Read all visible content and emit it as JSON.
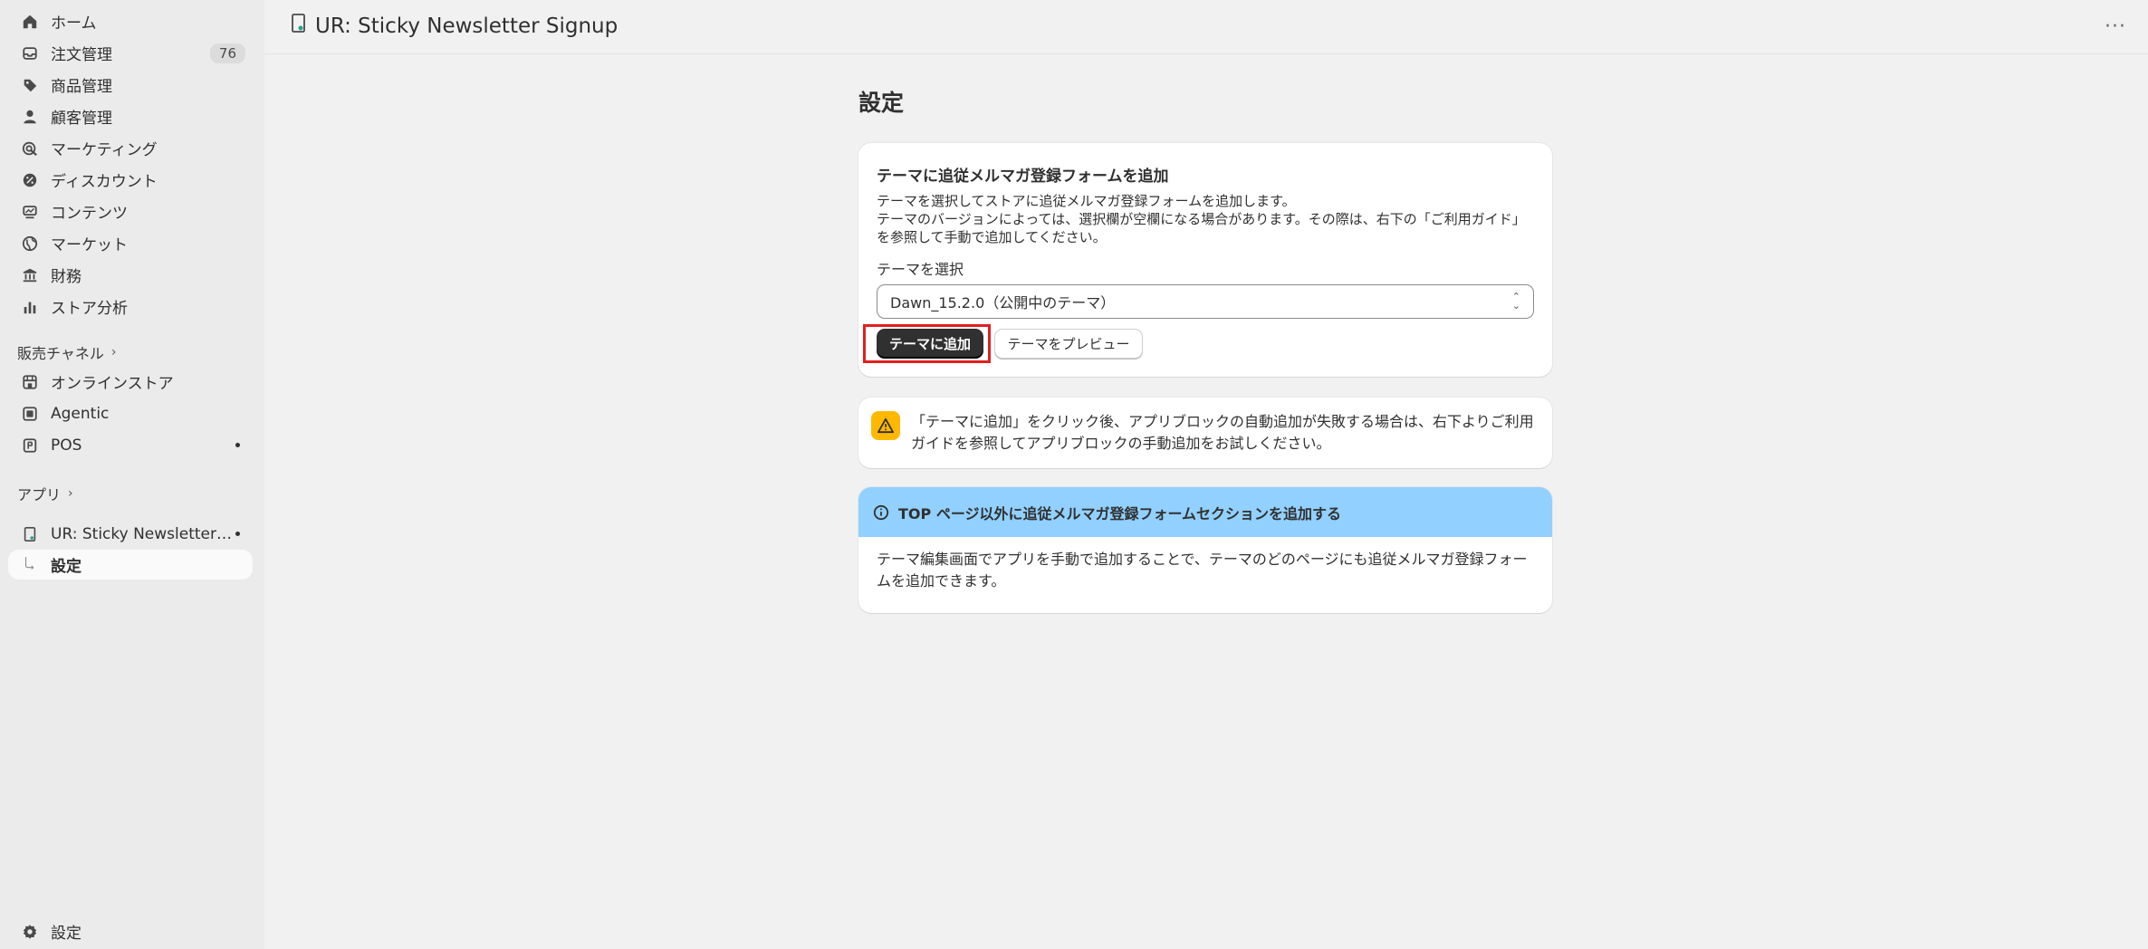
{
  "sidebar": {
    "items": [
      {
        "label": "ホーム",
        "icon": "home-icon"
      },
      {
        "label": "注文管理",
        "icon": "inbox-icon",
        "badge": "76"
      },
      {
        "label": "商品管理",
        "icon": "tag-icon"
      },
      {
        "label": "顧客管理",
        "icon": "person-icon"
      },
      {
        "label": "マーケティング",
        "icon": "target-icon"
      },
      {
        "label": "ディスカウント",
        "icon": "discount-icon"
      },
      {
        "label": "コンテンツ",
        "icon": "content-icon"
      },
      {
        "label": "マーケット",
        "icon": "globe-icon"
      },
      {
        "label": "財務",
        "icon": "bank-icon"
      },
      {
        "label": "ストア分析",
        "icon": "chart-bar-icon"
      }
    ],
    "sales_channels_title": "販売チャネル",
    "channels": [
      {
        "label": "オンラインストア",
        "icon": "store-icon"
      },
      {
        "label": "Agentic",
        "icon": "agentic-icon"
      },
      {
        "label": "POS",
        "icon": "pos-icon"
      }
    ],
    "apps_title": "アプリ",
    "apps": [
      {
        "label": "UR: Sticky Newsletter Signup",
        "icon": "app-icon"
      },
      {
        "label": "設定"
      }
    ],
    "settings_label": "設定"
  },
  "header": {
    "app_title": "UR: Sticky Newsletter Signup",
    "more": "···"
  },
  "main": {
    "page_title": "設定",
    "card1": {
      "title": "テーマに追従メルマガ登録フォームを追加",
      "desc_lines": [
        "テーマを選択してストアに追従メルマガ登録フォームを追加します。",
        "テーマのバージョンによっては、選択欄が空欄になる場合があります。その際は、右下の「ご利用ガイド」",
        "を参照して手動で追加してください。"
      ],
      "select_label": "テーマを選択",
      "select_value": "Dawn_15.2.0（公開中のテーマ）",
      "primary_button": "テーマに追加",
      "secondary_button": "テーマをプレビュー"
    },
    "card2": {
      "text": "「テーマに追加」をクリック後、アプリブロックの自動追加が失敗する場合は、右下よりご利用ガイドを参照してアプリブロックの手動追加をお試しください。"
    },
    "card3": {
      "banner": "TOP ページ以外に追従メルマガ登録フォームセクションを追加する",
      "body": "テーマ編集画面でアプリを手動で追加することで、テーマのどのページにも追従メルマガ登録フォームを追加できます。"
    }
  },
  "colors": {
    "sidebar_bg": "#ebebeb",
    "page_bg": "#f1f1f1",
    "primary_button": "#303030",
    "highlight": "#e02020",
    "warning": "#ffb800",
    "info_banner": "#91d0ff"
  }
}
